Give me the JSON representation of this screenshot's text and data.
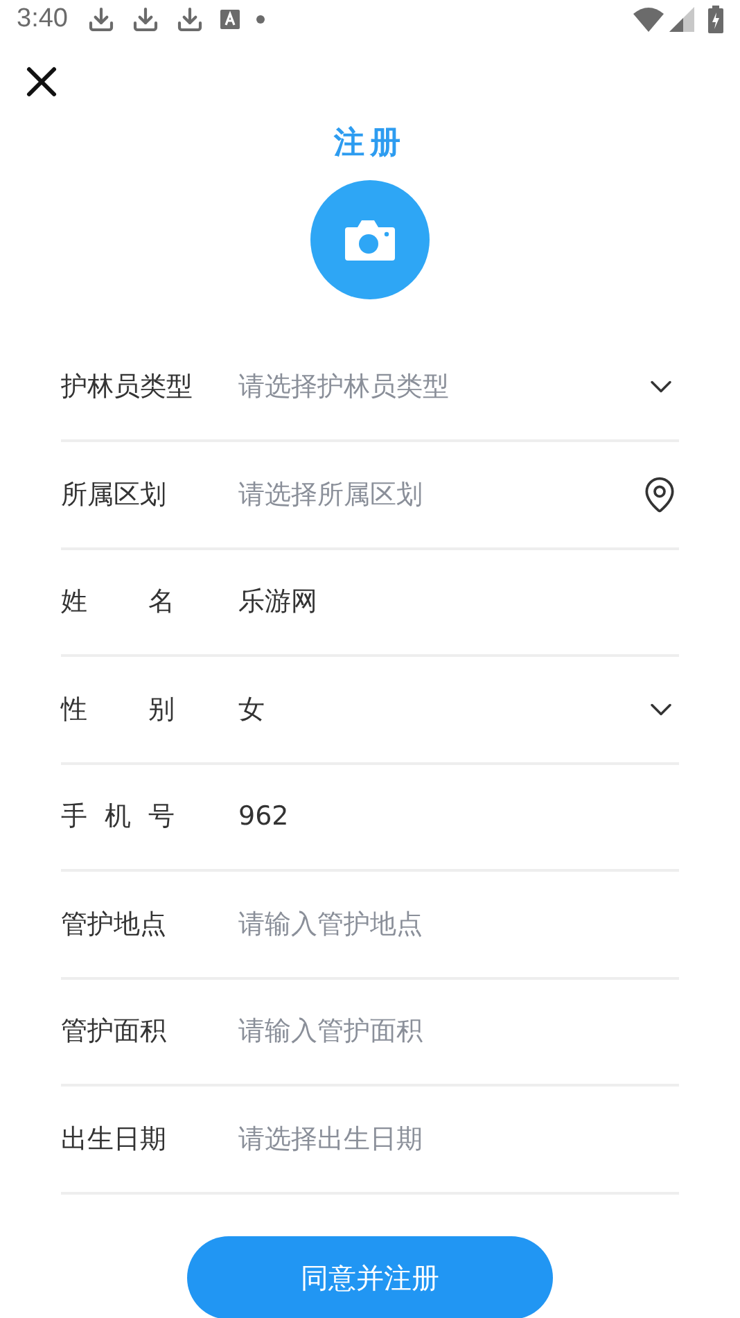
{
  "status_bar": {
    "time": "3:40"
  },
  "title": "注册",
  "fields": [
    {
      "label": "护林员类型",
      "kind": "select",
      "placeholder": "请选择护林员类型"
    },
    {
      "label": "所属区划",
      "kind": "location",
      "placeholder": "请选择所属区划"
    },
    {
      "label": "姓 名",
      "kind": "text",
      "value": "乐游网"
    },
    {
      "label": "性 别",
      "kind": "select",
      "value": "女"
    },
    {
      "label": "手 机 号",
      "kind": "text",
      "value": "962"
    },
    {
      "label": "管护地点",
      "kind": "text",
      "placeholder": "请输入管护地点"
    },
    {
      "label": "管护面积",
      "kind": "text",
      "placeholder": "请输入管护面积"
    },
    {
      "label": "出生日期",
      "kind": "text",
      "placeholder": "请选择出生日期"
    }
  ],
  "submit_button": "同意并注册"
}
